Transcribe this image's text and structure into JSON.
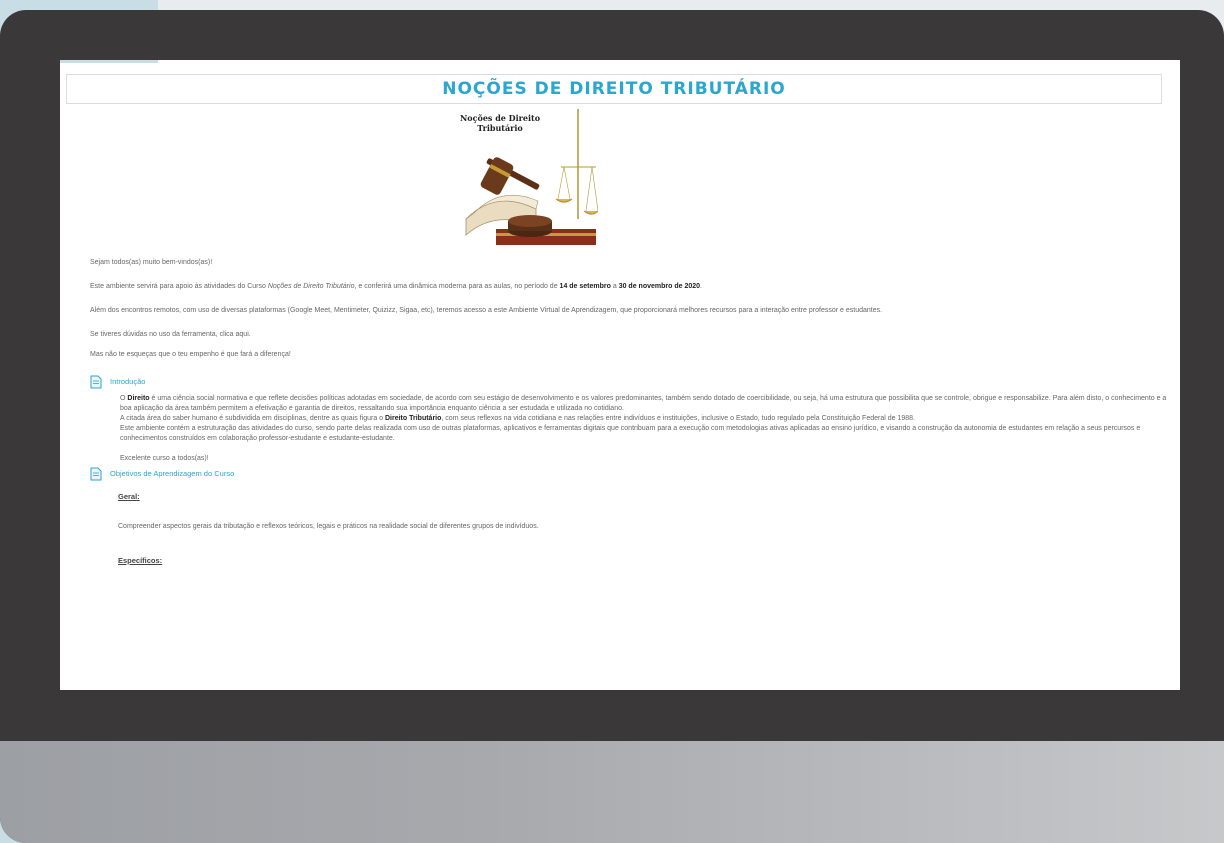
{
  "page": {
    "title": "NOÇÕES DE DIREITO TRIBUTÁRIO",
    "image_title_line1": "Noções de Direito",
    "image_title_line2": "Tributário"
  },
  "intro": {
    "greeting": "Sejam todos(as) muito bem-vindos(as)!",
    "p1_pre": "Este ambiente servirá para apoio às atividades do Curso ",
    "p1_course": "Noções de Direito Tributário",
    "p1_mid": ", e conferirá uma dinâmica moderna para as aulas, no período de ",
    "p1_date_start": "14 de setembro",
    "p1_and": " a ",
    "p1_date_end": "30 de novembro de 2020",
    "p1_end": ".",
    "p2": "Além dos encontros remotos, com uso de diversas plataformas (Google Meet, Mentimeter, Quizizz, Sigaa, etc), teremos acesso a este Ambiente Virtual de Aprendizagem, que proporcionará melhores recursos para a interação entre professor e estudantes.",
    "p3": "Se tiveres dúvidas no uso da ferramenta, clica aqui.",
    "p4": "Mas não te esqueças que o teu empenho é que fará a diferença!"
  },
  "sections": {
    "introducao": {
      "link": "Introdução",
      "b1_bold": "Direito",
      "b1_pre": "O ",
      "b1_rest": " é uma ciência social normativa e que reflete decisões políticas adotadas em sociedade, de acordo com seu estágio de desenvolvimento e os valores predominantes, também sendo dotado de coercibilidade, ou seja, há uma estrutura que possibilita que se controle, obrigue e responsabilize. Para além disto, o conhecimento e a boa aplicação da área também permitem a efetivação e garantia de direitos, ressaltando sua importância enquanto ciência a ser estudada e utilizada no cotidiano.",
      "b2_pre": "A citada área do saber humano é subdividida em disciplinas, dentre as quais figura o ",
      "b2_bold": "Direito Tributário",
      "b2_rest": ", com seus reflexos na vida cotidiana e nas relações entre indivíduos e instituições, inclusive o Estado, tudo regulado pela Constituição Federal de 1988.",
      "b3": "Este ambiente contém a estruturação das atividades do curso, sendo parte delas realizada com uso de outras plataformas, aplicativos e ferramentas digitais que contribuam para a execução com metodologias ativas aplicadas ao ensino jurídico, e visando a construção da autonomia de estudantes em relação a seus percursos e conhecimentos construídos em colaboração professor-estudante e estudante-estudante.",
      "closing": "Excelente curso a todos(as)!"
    },
    "objetivos": {
      "link": "Objetivos de Aprendizagem do Curso",
      "geral_label": "Geral:",
      "geral_text": "Compreender aspectos gerais da tributação e reflexos teóricos, legais e práticos na realidade social de diferentes grupos de indivíduos.",
      "especificos_label": "Específicos:"
    }
  },
  "colors": {
    "accent": "#2aa6cf",
    "frame": "#3a3839",
    "side_strip": "#c9dde6"
  },
  "icons": [
    "document-icon",
    "gavel-books-scales-image"
  ]
}
